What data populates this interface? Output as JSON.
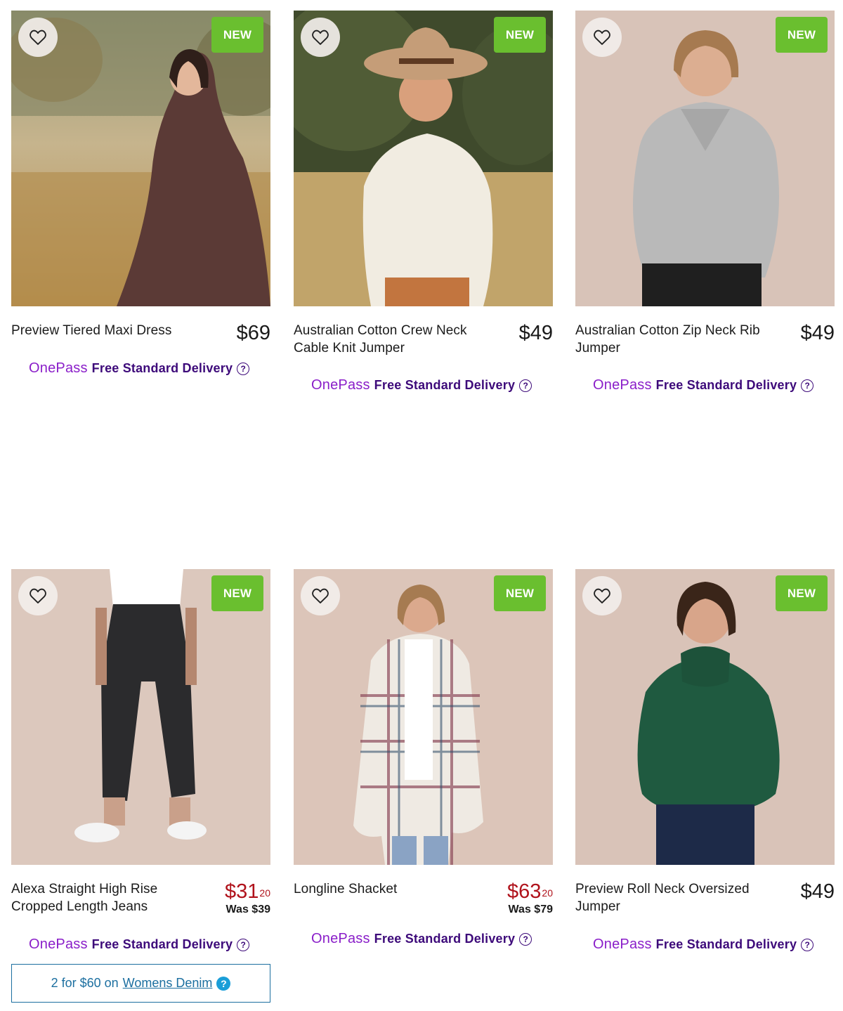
{
  "products": [
    {
      "name": "Preview Tiered Maxi Dress",
      "badge": "NEW",
      "price": "$69",
      "delivery_brand": "OnePass",
      "delivery_text": "Free Standard Delivery",
      "image": "woman-in-floral-maxi-dress-field"
    },
    {
      "name": "Australian Cotton Crew Neck Cable Knit Jumper",
      "badge": "NEW",
      "price": "$49",
      "delivery_brand": "OnePass",
      "delivery_text": "Free Standard Delivery",
      "image": "woman-in-hat-cream-jumper"
    },
    {
      "name": "Australian Cotton Zip Neck Rib Jumper",
      "badge": "NEW",
      "price": "$49",
      "delivery_brand": "OnePass",
      "delivery_text": "Free Standard Delivery",
      "image": "woman-in-grey-zip-jumper"
    },
    {
      "name": "Alexa Straight High Rise Cropped Length Jeans",
      "badge": "NEW",
      "price_dollars": "$31",
      "price_cents": "20",
      "was_price": "Was $39",
      "delivery_brand": "OnePass",
      "delivery_text": "Free Standard Delivery",
      "promo": {
        "prefix": "2 for $60 on",
        "link": "Womens Denim"
      },
      "image": "model-in-black-cropped-jeans"
    },
    {
      "name": "Longline Shacket",
      "badge": "NEW",
      "price_dollars": "$63",
      "price_cents": "20",
      "was_price": "Was $79",
      "delivery_brand": "OnePass",
      "delivery_text": "Free Standard Delivery",
      "image": "woman-in-check-shacket"
    },
    {
      "name": "Preview Roll Neck Oversized Jumper",
      "badge": "NEW",
      "price": "$49",
      "delivery_brand": "OnePass",
      "delivery_text": "Free Standard Delivery",
      "image": "woman-in-green-roll-neck"
    }
  ],
  "icons": {
    "wishlist": "heart-outline-icon",
    "help": "question-circle-icon"
  },
  "colors": {
    "new_badge": "#6abf2f",
    "sale_price": "#b0121b",
    "onepass_logo": "#8a1ec9",
    "onepass_text": "#3d0a7a",
    "promo": "#1c6fa0"
  }
}
